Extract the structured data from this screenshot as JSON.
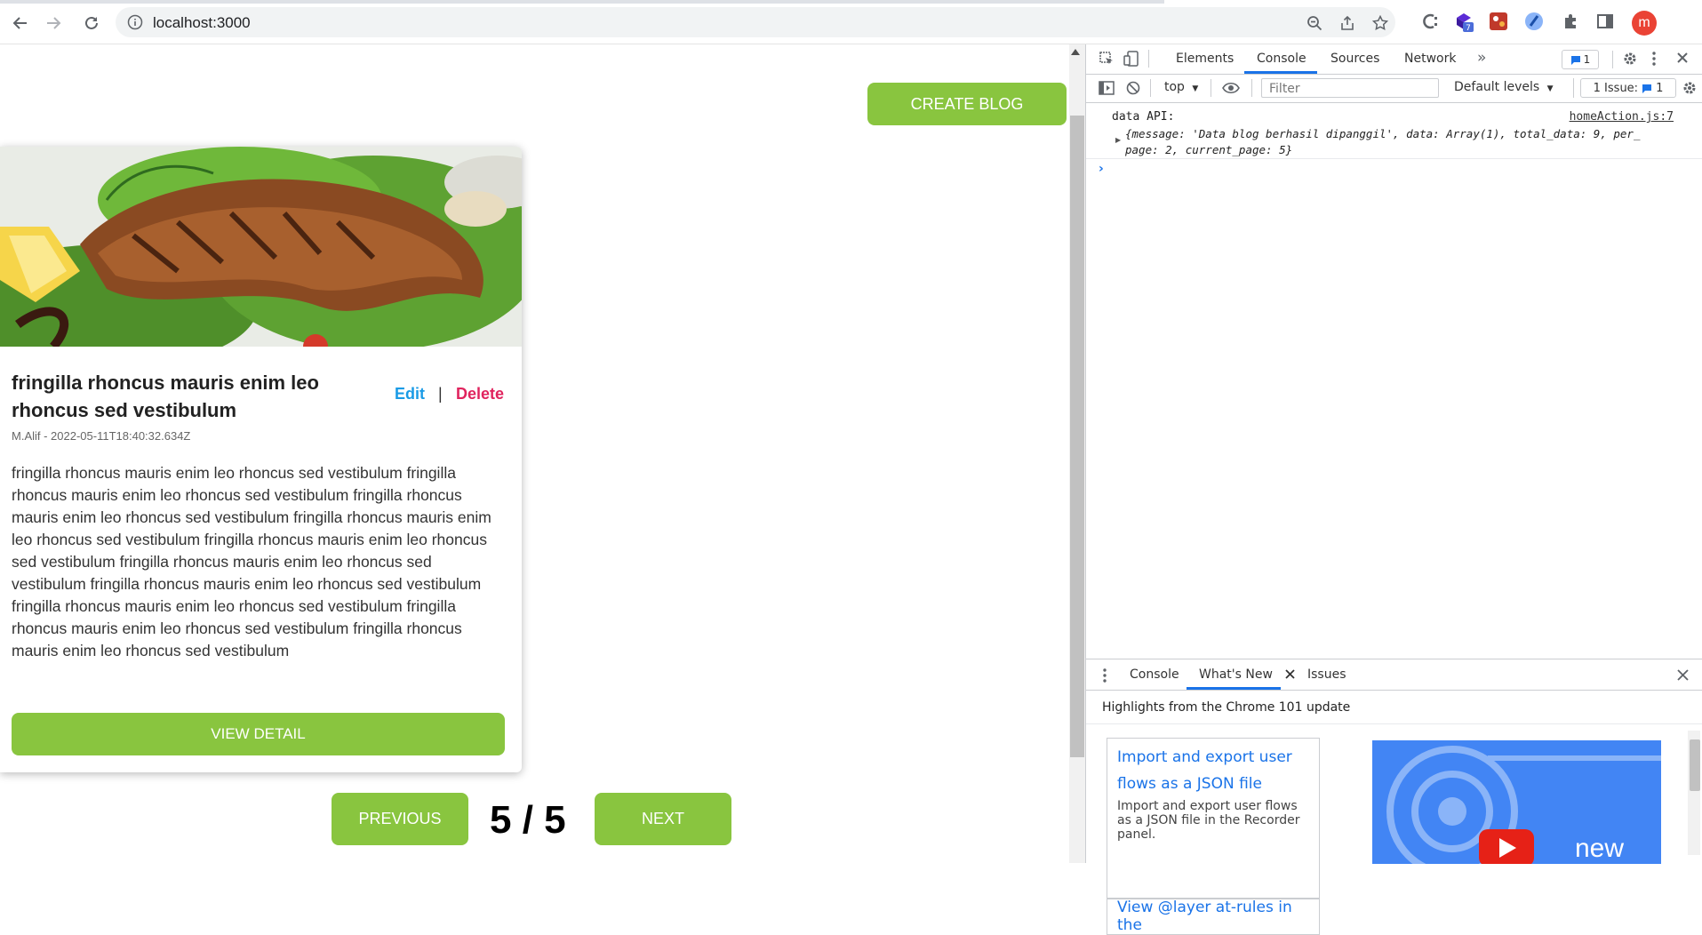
{
  "browser": {
    "url": "localhost:3000",
    "extension_badge": "7",
    "profile_initial": "m"
  },
  "page": {
    "create_button": "CREATE BLOG",
    "post": {
      "title": "fringilla rhoncus mauris enim leo rhoncus sed vestibulum",
      "edit_label": "Edit",
      "separator": "|",
      "delete_label": "Delete",
      "meta": "M.Alif - 2022-05-11T18:40:32.634Z",
      "body": "fringilla rhoncus mauris enim leo rhoncus sed vestibulum fringilla rhoncus mauris enim leo rhoncus sed vestibulum fringilla rhoncus mauris enim leo rhoncus sed vestibulum fringilla rhoncus mauris enim leo rhoncus sed vestibulum fringilla rhoncus mauris enim leo rhoncus sed vestibulum fringilla rhoncus mauris enim leo rhoncus sed vestibulum fringilla rhoncus mauris enim leo rhoncus sed vestibulum fringilla rhoncus mauris enim leo rhoncus sed vestibulum fringilla rhoncus mauris enim leo rhoncus sed vestibulum fringilla rhoncus mauris enim leo rhoncus sed vestibulum",
      "view_detail_label": "VIEW DETAIL"
    },
    "pagination": {
      "previous_label": "PREVIOUS",
      "indicator": "5 / 5",
      "next_label": "NEXT"
    }
  },
  "devtools": {
    "tabs": [
      "Elements",
      "Console",
      "Sources",
      "Network"
    ],
    "active_tab": "Console",
    "more_tabs": "»",
    "issues_count": "1",
    "context": "top",
    "filter_placeholder": "Filter",
    "levels": "Default levels",
    "issue_label": "1 Issue:",
    "issue_badge_count": "1",
    "log": {
      "label": "data API:",
      "source": "homeAction.js:7",
      "object_line1": "{message: 'Data blog berhasil dipanggil', data: Array(1), total_data: 9, per_",
      "object_line2": "page: 2, current_page: 5}"
    },
    "prompt": "›",
    "drawer": {
      "tabs": [
        "Console",
        "What's New",
        "Issues"
      ],
      "active_tab": "What's New",
      "heading": "Highlights from the Chrome 101 update",
      "feature_title": "Import and export user flows as a JSON file",
      "feature_desc": "Import and export user flows as a JSON file in the Recorder panel.",
      "next_feature_title": "View @layer at-rules in the",
      "promo_text": "new"
    }
  }
}
